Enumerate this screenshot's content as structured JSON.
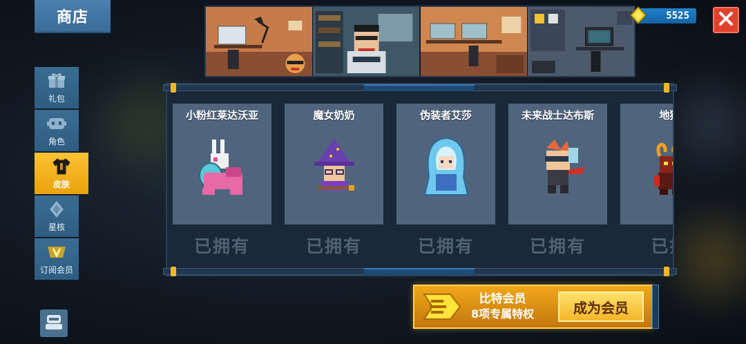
{
  "header": {
    "shop_title": "商店",
    "currency_amount": "5525",
    "currency_icon": "gem-icon",
    "close_icon": "close-icon"
  },
  "sidebar": {
    "items": [
      {
        "label": "礼包",
        "icon": "gift-icon",
        "active": false
      },
      {
        "label": "角色",
        "icon": "character-icon",
        "active": false
      },
      {
        "label": "皮肤",
        "icon": "skin-shirt-icon",
        "active": true
      },
      {
        "label": "星核",
        "icon": "star-core-icon",
        "active": false
      },
      {
        "label": "订阅会员",
        "icon": "vip-badge-icon",
        "active": false
      }
    ],
    "bottom_icon": "avatar-icon"
  },
  "cards": [
    {
      "name": "小粉红莱达沃亚",
      "status": "已拥有"
    },
    {
      "name": "魔女奶奶",
      "status": "已拥有"
    },
    {
      "name": "伪装者艾莎",
      "status": "已拥有"
    },
    {
      "name": "未来战士达布斯",
      "status": "已拥有"
    },
    {
      "name": "地狱",
      "status": "已拥"
    }
  ],
  "vip": {
    "title": "比特会员",
    "subtitle": "8项专属特权",
    "button": "成为会员"
  },
  "colors": {
    "accent_gold": "#f3b62a",
    "tab_blue": "#3a6c92",
    "close_red": "#e0412d"
  }
}
